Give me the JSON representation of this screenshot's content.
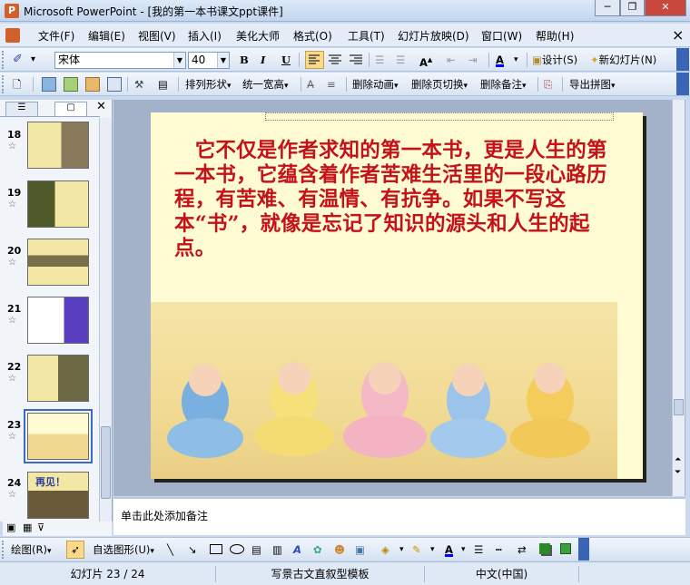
{
  "window": {
    "title": "Microsoft PowerPoint - [我的第一本书课文ppt课件]",
    "minimize": "─",
    "restore": "❐",
    "close": "✕"
  },
  "menu": {
    "items": [
      "文件(F)",
      "编辑(E)",
      "视图(V)",
      "插入(I)",
      "美化大师",
      "格式(O)",
      "工具(T)",
      "幻灯片放映(D)",
      "窗口(W)",
      "帮助(H)"
    ],
    "close": "×"
  },
  "format_toolbar": {
    "font": "宋体",
    "size": "40",
    "bold": "B",
    "italic": "I",
    "underline": "U",
    "design": "设计(S)",
    "new_slide": "新幻灯片(N)"
  },
  "toolbar3": {
    "arrange": "排列形状",
    "unify": "统一宽高",
    "delete_animation": "删除动画",
    "delete_transition": "删除页切换",
    "delete_notes": "删除备注",
    "export": "导出拼图"
  },
  "slides": [
    {
      "num": "18"
    },
    {
      "num": "19"
    },
    {
      "num": "20"
    },
    {
      "num": "21"
    },
    {
      "num": "22"
    },
    {
      "num": "23"
    },
    {
      "num": "24"
    }
  ],
  "thumb24_text": "再见！",
  "slide": {
    "text": "　它不仅是作者求知的第一本书，更是人生的第一本书，它蕴含着作者苦难生活里的一段心路历程，有苦难、有温情、有抗争。如果不写这本“书”，就像是忘记了知识的源头和人生的起点。"
  },
  "notes": {
    "placeholder": "单击此处添加备注"
  },
  "draw_toolbar": {
    "draw": "绘图(R)",
    "autoshapes": "自选图形(U)"
  },
  "status": {
    "slide": "幻灯片 23 / 24",
    "template": "写景古文直叙型模板",
    "language": "中文(中国)"
  },
  "colors": {
    "slide_text": "#c4121a",
    "slide_bg": "#fffcd3"
  }
}
